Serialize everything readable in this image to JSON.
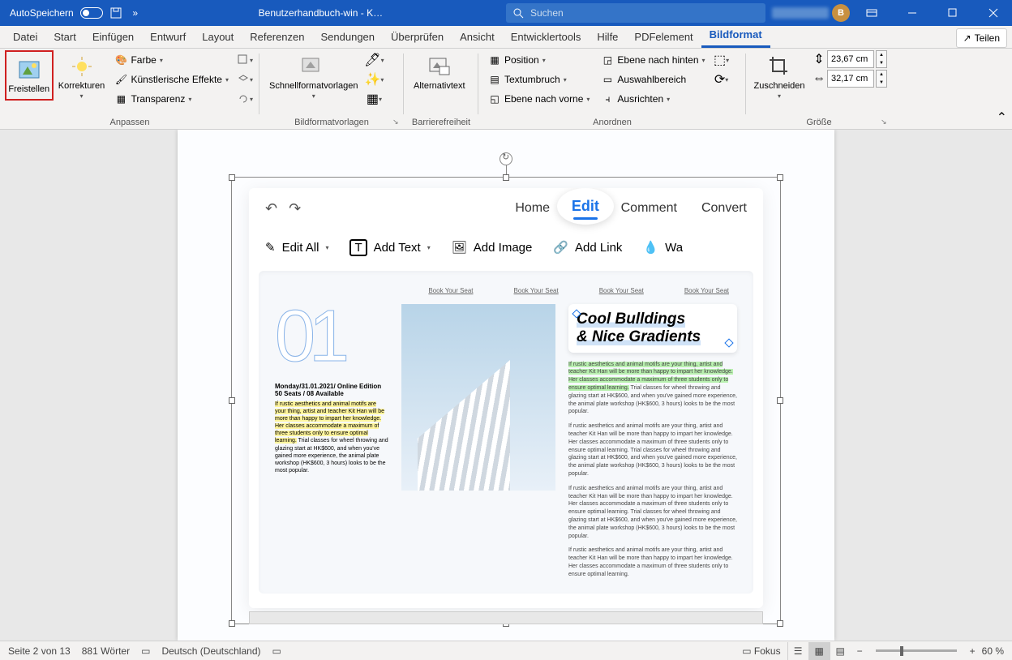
{
  "titlebar": {
    "autosave": "AutoSpeichern",
    "doc_title": "Benutzerhandbuch-win  -  K…",
    "search_placeholder": "Suchen",
    "avatar_initial": "B"
  },
  "tabs": {
    "datei": "Datei",
    "start": "Start",
    "einfuegen": "Einfügen",
    "entwurf": "Entwurf",
    "layout": "Layout",
    "referenzen": "Referenzen",
    "sendungen": "Sendungen",
    "ueberpruefen": "Überprüfen",
    "ansicht": "Ansicht",
    "entwickler": "Entwicklertools",
    "hilfe": "Hilfe",
    "pdfelement": "PDFelement",
    "bildformat": "Bildformat",
    "teilen": "Teilen"
  },
  "ribbon": {
    "freistellen": "Freistellen",
    "korrekturen": "Korrekturen",
    "farbe": "Farbe",
    "kuenstlerische": "Künstlerische Effekte",
    "transparenz": "Transparenz",
    "anpassen": "Anpassen",
    "schnellformat": "Schnellformatvorlagen",
    "bildformatvorlagen": "Bildformatvorlagen",
    "alternativtext": "Alternativtext",
    "barrierefreiheit": "Barrierefreiheit",
    "position": "Position",
    "textumbruch": "Textumbruch",
    "ebene_vorne": "Ebene nach vorne",
    "ebene_hinten": "Ebene nach hinten",
    "auswahlbereich": "Auswahlbereich",
    "ausrichten": "Ausrichten",
    "anordnen": "Anordnen",
    "zuschneiden": "Zuschneiden",
    "height": "23,67 cm",
    "width": "32,17 cm",
    "groesse": "Größe"
  },
  "pdf": {
    "home": "Home",
    "edit": "Edit",
    "comment": "Comment",
    "convert": "Convert",
    "edit_all": "Edit All",
    "add_text": "Add Text",
    "add_image": "Add Image",
    "add_link": "Add Link",
    "wa": "Wa",
    "book_seat": "Book Your Seat",
    "title1": "Cool Bulldings",
    "title2": "& Nice Gradients",
    "date": "Monday/31.01.2021/ Online Edition",
    "seats": "50 Seats / 08 Available",
    "body": "If rustic aesthetics and animal motifs are your thing, artist and teacher Kit Han will be more than happy to impart her knowledge. Her classes accommodate a maximum of three students only to ensure optimal learning. Trial classes for wheel throwing and glazing start at HK$600, and when you've gained more experience, the animal plate workshop (HK$600, 3 hours) looks to be the most popular.",
    "body_hl1": "If rustic aesthetics and animal motifs are your thing, artist and teacher Kit Han will be more than happy to impart her knowledge. Her classes accommodate a maximum of three students only to ensure optimal learning.",
    "body_hl2_a": "If rustic aesthetics and animal motifs are your thing, artist and teacher Kit Han will be more than happy to impart her knowledge. Her classes accommodate a maximum of three students only to ensure optimal learning.",
    "body_rest": " Trial classes for wheel throwing and glazing start at HK$600, and when you've gained more experience, the animal plate workshop (HK$600, 3 hours) looks to be the most popular.",
    "short": "If rustic aesthetics and animal motifs are your thing, artist and teacher Kit Han will be more than happy to impart her knowledge. Her classes accommodate a maximum of three students only to ensure optimal learning."
  },
  "status": {
    "page": "Seite 2 von 13",
    "words": "881 Wörter",
    "lang": "Deutsch (Deutschland)",
    "fokus": "Fokus",
    "zoom": "60 %"
  }
}
